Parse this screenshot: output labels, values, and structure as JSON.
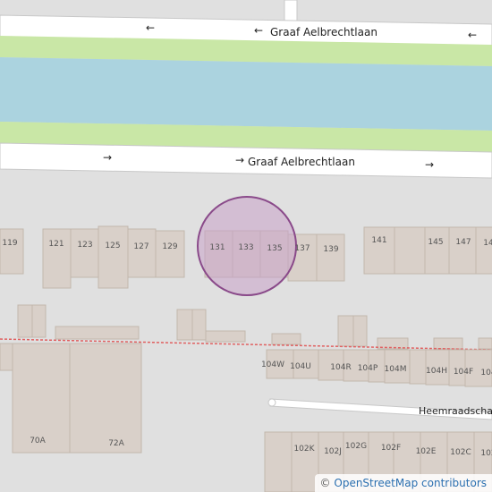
{
  "map": {
    "colors": {
      "background": "#e0e0e0",
      "road": "#ffffff",
      "road_outline": "#c8c8c8",
      "grass": "#c9e7a6",
      "water": "#abd3df",
      "building": "#d9d0c9",
      "building_outline": "#c2b7ad",
      "highlight_fill": "#c8a2c8",
      "highlight_stroke": "#8a4a8a",
      "railway": "#e06060",
      "label": "#555555",
      "road_label": "#222222"
    },
    "streets": [
      {
        "name": "Graaf Aelbrechtlaan",
        "direction": "westbound",
        "arrows": [
          "←",
          "←",
          "←"
        ]
      },
      {
        "name": "Graaf Aelbrechtlaan",
        "direction": "eastbound",
        "arrows": [
          "→",
          "→",
          "→"
        ]
      },
      {
        "name": "Heemraadschap"
      }
    ],
    "house_numbers_row1": [
      "119",
      "121",
      "123",
      "125",
      "127",
      "129",
      "131",
      "133",
      "135",
      "137",
      "139",
      "141",
      "145",
      "147",
      "14"
    ],
    "house_numbers_row2": [
      "104W",
      "104U",
      "104R",
      "104P",
      "104M",
      "104H",
      "104F",
      "104"
    ],
    "house_numbers_row3": [
      "102K",
      "102J",
      "102G",
      "102F",
      "102E",
      "102C",
      "102"
    ],
    "house_numbers_row4": [
      "70A",
      "72A"
    ],
    "highlighted_addresses": [
      "131",
      "133",
      "135"
    ],
    "attribution": {
      "symbol": "©",
      "text": "OpenStreetMap contributors"
    }
  }
}
